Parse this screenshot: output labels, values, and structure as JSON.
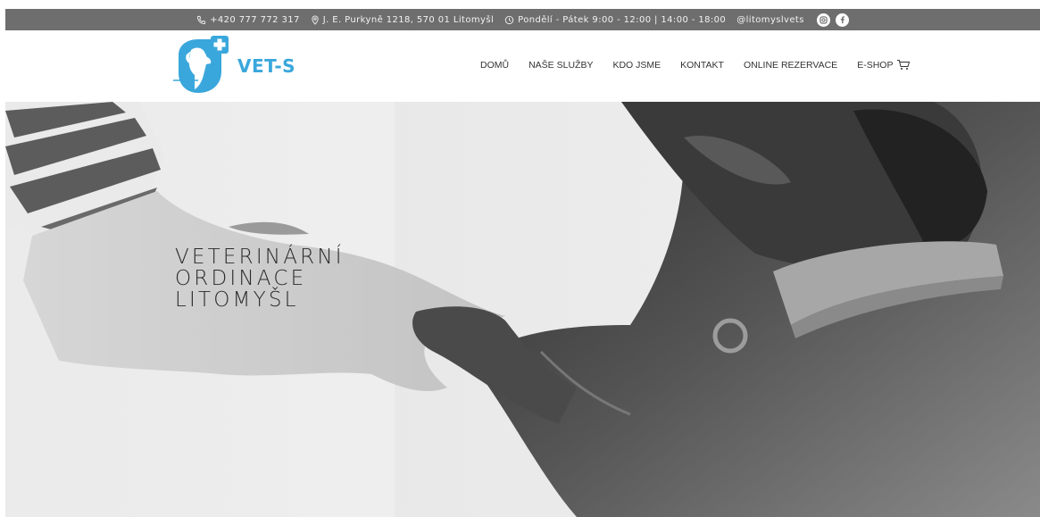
{
  "topbar": {
    "phone": "+420 777 772 317",
    "address": "J. E. Purkyně 1218, 570 01 Litomyšl",
    "hours": "Pondělí - Pátek 9:00 - 12:00 | 14:00 - 18:00",
    "handle": "@litomyslvets",
    "icons": [
      "phone-icon",
      "location-pin-icon",
      "clock-icon",
      "instagram-icon",
      "facebook-icon"
    ]
  },
  "header": {
    "logo_text": "VET-S",
    "brand_color": "#3aa7dc"
  },
  "nav": {
    "items": [
      "DOMŮ",
      "NAŠE SLUŽBY",
      "KDO JSME",
      "KONTAKT",
      "ONLINE REZERVACE",
      "E-SHOP"
    ]
  },
  "hero": {
    "title_lines": [
      "VETERINÁRNÍ",
      "ORDINACE",
      "LITOMYŠL"
    ]
  },
  "colors": {
    "topbar_bg": "#6e6e6e",
    "accent": "#3aa7dc"
  }
}
